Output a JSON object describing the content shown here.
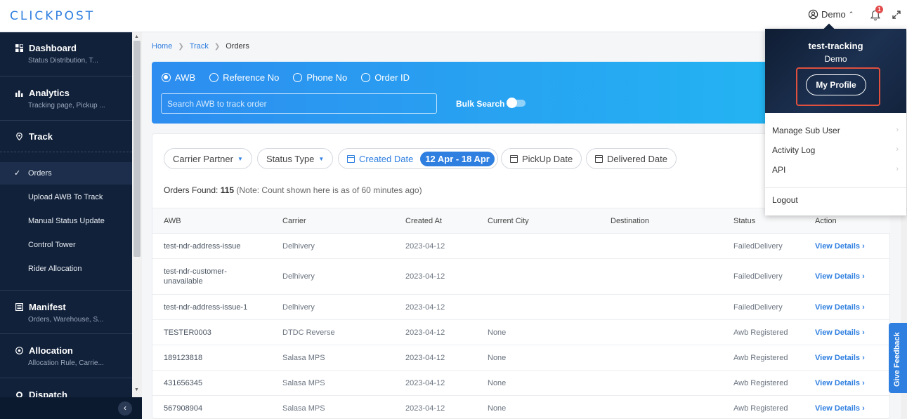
{
  "app": {
    "logo": "CLICKPOST"
  },
  "header": {
    "user_name": "Demo",
    "notification_count": "1"
  },
  "sidebar": {
    "sections": [
      {
        "title": "Dashboard",
        "subtitle": "Status Distribution, T..."
      },
      {
        "title": "Analytics",
        "subtitle": "Tracking page, Pickup ..."
      },
      {
        "title": "Track"
      },
      {
        "title": "Manifest",
        "subtitle": "Orders, Warehouse, S..."
      },
      {
        "title": "Allocation",
        "subtitle": "Allocation Rule, Carrie..."
      },
      {
        "title": "Dispatch"
      }
    ],
    "track_items": [
      "Orders",
      "Upload AWB To Track",
      "Manual Status Update",
      "Control Tower",
      "Rider Allocation"
    ],
    "active_item": "Orders"
  },
  "breadcrumb": {
    "home": "Home",
    "track": "Track",
    "current": "Orders"
  },
  "search": {
    "options": [
      "AWB",
      "Reference No",
      "Phone No",
      "Order ID"
    ],
    "selected": "AWB",
    "placeholder": "Search AWB to track order",
    "bulk_label": "Bulk Search"
  },
  "filters": {
    "carrier": "Carrier Partner",
    "status": "Status Type",
    "created": "Created Date",
    "created_range": "12 Apr - 18 Apr",
    "pickup": "PickUp Date",
    "delivered": "Delivered Date"
  },
  "orders_found": {
    "label": "Orders Found:",
    "count": "115",
    "note": "(Note: Count shown here is as of 60 minutes ago)"
  },
  "table": {
    "headers": [
      "AWB",
      "Carrier",
      "Created At",
      "Current City",
      "Destination",
      "Status",
      "Action"
    ],
    "rows": [
      {
        "awb": "test-ndr-address-issue",
        "carrier": "Delhivery",
        "created": "2023-04-12",
        "city": "",
        "destination": "",
        "status": "FailedDelivery",
        "action": "View Details"
      },
      {
        "awb": "test-ndr-customer-unavailable",
        "carrier": "Delhivery",
        "created": "2023-04-12",
        "city": "",
        "destination": "",
        "status": "FailedDelivery",
        "action": "View Details"
      },
      {
        "awb": "test-ndr-address-issue-1",
        "carrier": "Delhivery",
        "created": "2023-04-12",
        "city": "",
        "destination": "",
        "status": "FailedDelivery",
        "action": "View Details"
      },
      {
        "awb": "TESTER0003",
        "carrier": "DTDC Reverse",
        "created": "2023-04-12",
        "city": "None",
        "destination": "",
        "status": "Awb Registered",
        "action": "View Details"
      },
      {
        "awb": "189123818",
        "carrier": "Salasa MPS",
        "created": "2023-04-12",
        "city": "None",
        "destination": "",
        "status": "Awb Registered",
        "action": "View Details"
      },
      {
        "awb": "431656345",
        "carrier": "Salasa MPS",
        "created": "2023-04-12",
        "city": "None",
        "destination": "",
        "status": "Awb Registered",
        "action": "View Details"
      },
      {
        "awb": "567908904",
        "carrier": "Salasa MPS",
        "created": "2023-04-12",
        "city": "None",
        "destination": "",
        "status": "Awb Registered",
        "action": "View Details"
      }
    ]
  },
  "profile_menu": {
    "account": "test-tracking",
    "role": "Demo",
    "profile_button": "My Profile",
    "items": [
      "Manage Sub User",
      "Activity Log",
      "API"
    ],
    "logout": "Logout"
  },
  "feedback": {
    "label": "Give Feedback"
  },
  "colors": {
    "accent": "#2f7fe0",
    "sidebar": "#11213a",
    "highlight": "#e0503e"
  }
}
